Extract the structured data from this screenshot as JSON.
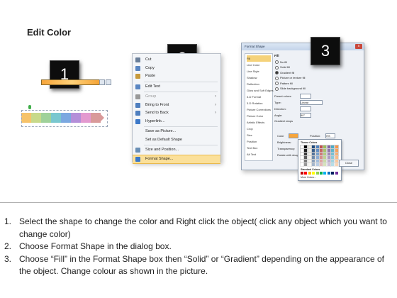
{
  "title": "Edit Color",
  "badges": [
    "1",
    "2",
    "3"
  ],
  "panel1": {
    "arrow_colors": [
      "#f6c36a",
      "#c7d98a",
      "#9fd19a",
      "#79c7cf",
      "#7ba8e0",
      "#b48fd9",
      "#e39ad0",
      "#d99a9a"
    ]
  },
  "context_menu": {
    "items": [
      {
        "label": "Cut",
        "icon": "scissors-icon"
      },
      {
        "label": "Copy",
        "icon": "copy-icon"
      },
      {
        "label": "Paste",
        "icon": "paste-icon"
      },
      {
        "label": "Edit Text",
        "icon": "edit-text-icon"
      },
      {
        "label": "Group",
        "icon": "group-icon",
        "disabled": true,
        "submenu": true
      },
      {
        "label": "Bring to Front",
        "icon": "bring-to-front-icon",
        "submenu": true
      },
      {
        "label": "Send to Back",
        "icon": "send-to-back-icon",
        "submenu": true
      },
      {
        "label": "Hyperlink...",
        "icon": "hyperlink-icon"
      },
      {
        "label": "Save as Picture...",
        "icon": ""
      },
      {
        "label": "Set as Default Shape",
        "icon": ""
      },
      {
        "label": "Size and Position...",
        "icon": "size-position-icon"
      },
      {
        "label": "Format Shape...",
        "icon": "format-shape-icon",
        "highlighted": true
      }
    ]
  },
  "dialog": {
    "title": "Format Shape",
    "close_glyph": "x",
    "nav": [
      "Fill",
      "Line Color",
      "Line Style",
      "Shadow",
      "Reflection",
      "Glow and Soft Edges",
      "3-D Format",
      "3-D Rotation",
      "Picture Corrections",
      "Picture Color",
      "Artistic Effects",
      "Crop",
      "Size",
      "Position",
      "Text Box",
      "Alt Text"
    ],
    "section_title": "Fill",
    "fill_options": [
      "No fill",
      "Solid fill",
      "Gradient fill",
      "Picture or texture fill",
      "Pattern fill",
      "Slide background fill"
    ],
    "preset_colors_label": "Preset colors:",
    "type_label": "Type:",
    "type_value": "Linear",
    "direction_label": "Direction:",
    "angle_label": "Angle:",
    "angle_value": "90°",
    "gradient_stops_label": "Gradient stops",
    "color_label": "Color",
    "position_label": "Position:",
    "position_value": "0%",
    "brightness_label": "Brightness:",
    "transparency_label": "Transparency:",
    "rotate_label": "Rotate with shape",
    "theme_colors_label": "Theme Colors",
    "standard_colors_label": "Standard Colors",
    "more_colors_label": "More Colors...",
    "close_label": "Close"
  },
  "steps": [
    {
      "num": "1.",
      "text": "Select the shape to change the color and Right click the object( click any object which you want to change color)"
    },
    {
      "num": "2.",
      "text": "Choose Format Shape in the dialog box."
    },
    {
      "num": "3.",
      "text": "Choose “Fill” in the Format Shape box then “Solid” or “Gradient” depending on the appearance of the object. Change colour as shown in the picture."
    }
  ]
}
